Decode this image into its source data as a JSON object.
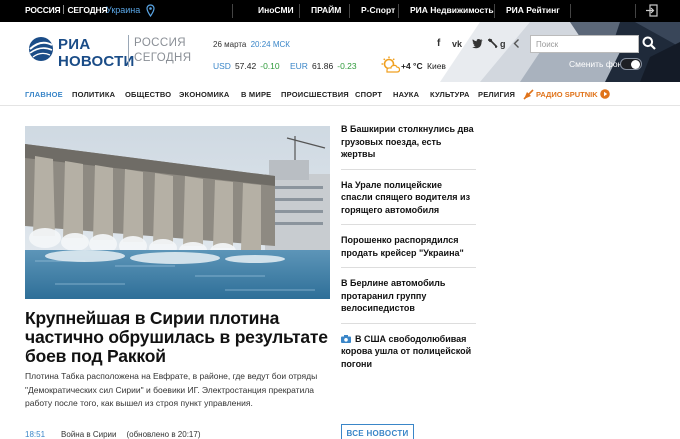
{
  "topbar": {
    "logo_left": "РОССИЯ",
    "logo_right": "СЕГОДНЯ",
    "region": "Украина",
    "links": [
      "ИноСМИ",
      "ПРАЙМ",
      "Р-Спорт",
      "РИА Недвижимость",
      "РИА Рейтинг"
    ]
  },
  "header": {
    "logo_ria": "РИА",
    "logo_news": "НОВОСТИ",
    "logo_rs_line1": "РОССИЯ",
    "logo_rs_line2": "СЕГОДНЯ",
    "date": "26 марта",
    "time": "20:24 МСК",
    "rates": [
      {
        "currency": "USD",
        "value": "57.42",
        "change": "-0.10"
      },
      {
        "currency": "EUR",
        "value": "61.86",
        "change": "-0.23"
      }
    ],
    "weather": {
      "temp": "+4 °C",
      "city": "Киев",
      "icon": "sun-cloud-icon"
    },
    "social": [
      "facebook-icon",
      "vk-icon",
      "twitter-icon",
      "lj-icon",
      "googleplus-icon",
      "chevron-left-icon"
    ],
    "search_placeholder": "Поиск",
    "bg_toggle_label": "Сменить фон"
  },
  "nav": {
    "items": [
      "ГЛАВНОЕ",
      "ПОЛИТИКА",
      "ОБЩЕСТВО",
      "ЭКОНОМИКА",
      "В МИРЕ",
      "ПРОИСШЕСТВИЯ",
      "СПОРТ",
      "НАУКА",
      "КУЛЬТУРА",
      "РЕЛИГИЯ"
    ],
    "sputnik": "РАДИО SPUTNIK",
    "active": "ГЛАВНОЕ"
  },
  "main": {
    "headline": "Крупнейшая в Сирии плотина частично обрушилась в результате боев под Раккой",
    "lead": "Плотина Табка расположена на Евфрате, в районе, где ведут бои отряды \"Демократических сил Сирии\" и боевики ИГ. Электростанция прекратила работу после того, как вышел из строя пункт управления.",
    "time": "18:51",
    "category": "Война в Сирии",
    "updated": "(обновлено в 20:17)"
  },
  "feed": {
    "items": [
      {
        "text": "В Башкирии столкнулись два грузовых поезда, есть жертвы",
        "has_camera": false
      },
      {
        "text": "На Урале полицейские спасли спящего водителя из горящего автомобиля",
        "has_camera": false
      },
      {
        "text": "Порошенко распорядился продать крейсер \"Украина\"",
        "has_camera": false
      },
      {
        "text": "В Берлине автомобиль протаранил группу велосипедистов",
        "has_camera": false
      },
      {
        "text": "В США свободолюбивая корова ушла от полицейской погони",
        "has_camera": true
      }
    ],
    "all_news_label": "ВСЕ НОВОСТИ"
  },
  "colors": {
    "brand": "#1a4c87",
    "accent": "#3a86c8",
    "sputnik": "#e0731a",
    "positive": "#2e9a3a"
  }
}
